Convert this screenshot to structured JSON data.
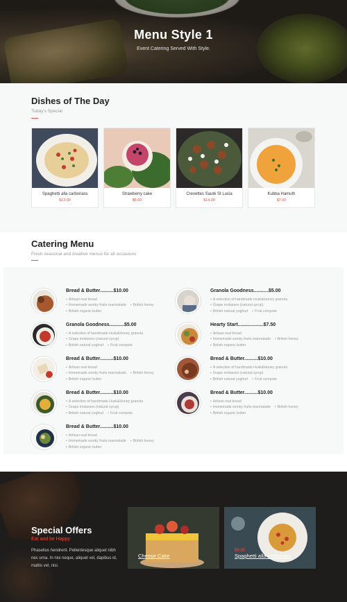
{
  "hero": {
    "title": "Menu Style 1",
    "subtitle": "Event Catering Served With Style."
  },
  "dishes": {
    "title": "Dishes of The Day",
    "subtitle": "Today's Special",
    "items": [
      {
        "name": "Spaghetti alla carbonara",
        "price": "$12.00"
      },
      {
        "name": "Strawberry cake",
        "price": "$5.00"
      },
      {
        "name": "Crevettes Sauté St Lucia",
        "price": "$14.00"
      },
      {
        "name": "Kubba Hamuth",
        "price": "$7.00"
      }
    ]
  },
  "catering": {
    "title": "Catering Menu",
    "subtitle": "Fresh seasonal and creative menus for all occasions",
    "items": [
      {
        "title": "Bread & Butter..........$10.00",
        "bullets": [
          "Artisan real bread",
          "Homemade wonky fruits marmalade",
          "British honey",
          "British organic butter"
        ]
      },
      {
        "title": "Granola Goodness...........$5.00",
        "bullets": [
          "A selection of handmade Husk&Honey granola",
          "Grape molasses (natural syrup)",
          "British natural yoghurt",
          "Fruit compote"
        ]
      },
      {
        "title": "Granola Goodness...........$5.00",
        "bullets": [
          "A selection of handmade Husk&Honey granola",
          "Grape molasses (natural syrup)",
          "British natural yoghurt",
          "Fruit compote"
        ]
      },
      {
        "title": "Hearty Start...................$7.50",
        "bullets": [
          "Artisan real bread",
          "Homemade wonky fruits marmalade",
          "British honey",
          "British organic butter"
        ]
      },
      {
        "title": "Bread & Butter..........$10.00",
        "bullets": [
          "Artisan real bread",
          "Homemade wonky fruits marmalade",
          "British honey",
          "British organic butter"
        ]
      },
      {
        "title": "Bread & Butter..........$10.00",
        "bullets": [
          "A selection of handmade Husk&Honey granola",
          "Grape molasses (natural syrup)",
          "British natural yoghurt",
          "Fruit compote"
        ]
      },
      {
        "title": "Bread & Butter..........$10.00",
        "bullets": [
          "A selection of handmade Husk&Honey granola",
          "Grape molasses (natural syrup)",
          "British natural yoghurt",
          "Fruit compote"
        ]
      },
      {
        "title": "Bread & Butter..........$10.00",
        "bullets": [
          "Artisan real bread",
          "Homemade wonky fruits marmalade",
          "British honey",
          "British organic butter"
        ]
      },
      {
        "title": "Bread & Butter..........$10.00",
        "bullets": [
          "Artisan real bread",
          "Homemade wonky fruits marmalade",
          "British honey",
          "British organic butter"
        ]
      }
    ]
  },
  "offers": {
    "title": "Special Offers",
    "subtitle": "Eat and be Happy",
    "text": "Phasellus hendrerit. Pellentesque aliquet nibh nec urna. In nisi neque, aliquet vel, dapibus id, mattis vel, nisi.",
    "cards": [
      {
        "name": "Cheese Cake",
        "price": ""
      },
      {
        "name": "Spaghetti alla carbonara",
        "price": "$9.95"
      }
    ]
  },
  "colors": {
    "accent": "#e84c3d",
    "dark_bg": "#1f1d1c",
    "light_bg": "#f7f9f9"
  }
}
